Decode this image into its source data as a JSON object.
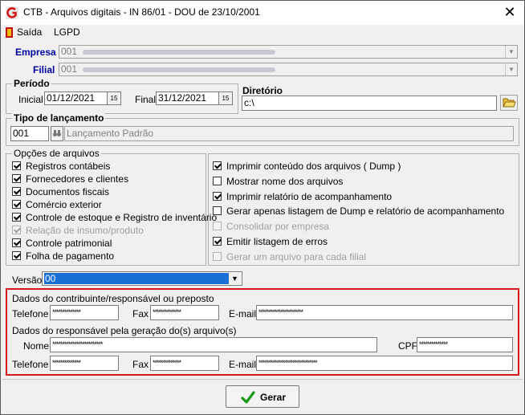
{
  "window": {
    "title": "CTB - Arquivos digitais - IN 86/01 - DOU de 23/10/2001",
    "close_symbol": "✕"
  },
  "menu": {
    "exit": "Saída",
    "lgpd": "LGPD"
  },
  "company": {
    "label": "Empresa",
    "code": "001"
  },
  "branch": {
    "label": "Filial",
    "code": "001"
  },
  "period": {
    "title": "Período",
    "start_label": "Inicial",
    "start_value": "01/12/2021",
    "end_label": "Final",
    "end_value": "31/12/2021",
    "cal_glyph": "15"
  },
  "directory": {
    "label": "Diretório",
    "value": "c:\\"
  },
  "entry_type": {
    "title": "Tipo de lançamento",
    "code": "001",
    "description": "Lançamento Padrão"
  },
  "file_options": {
    "title": "Opções de arquivos",
    "left": [
      {
        "label": "Registros contábeis",
        "checked": true,
        "enabled": true
      },
      {
        "label": "Fornecedores e clientes",
        "checked": true,
        "enabled": true
      },
      {
        "label": "Documentos fiscais",
        "checked": true,
        "enabled": true
      },
      {
        "label": "Comércio exterior",
        "checked": true,
        "enabled": true
      },
      {
        "label": "Controle de estoque e Registro de inventário",
        "checked": true,
        "enabled": true
      },
      {
        "label": "Relação de insumo/produto",
        "checked": true,
        "enabled": false
      },
      {
        "label": "Controle patrimonial",
        "checked": true,
        "enabled": true
      },
      {
        "label": "Folha de pagamento",
        "checked": true,
        "enabled": true
      }
    ],
    "right": [
      {
        "label": "Imprimir conteúdo dos arquivos ( Dump )",
        "checked": true,
        "enabled": true
      },
      {
        "label": "Mostrar nome dos arquivos",
        "checked": false,
        "enabled": true
      },
      {
        "label": "Imprimir relatório de acompanhamento",
        "checked": true,
        "enabled": true
      },
      {
        "label": "Gerar apenas listagem de Dump e relatório de acompanhamento",
        "checked": false,
        "enabled": true
      },
      {
        "label": "Consolidar por empresa",
        "checked": false,
        "enabled": false
      },
      {
        "label": "Emitir listagem de erros",
        "checked": true,
        "enabled": true
      },
      {
        "label": "Gerar um arquivo para cada filial",
        "checked": false,
        "enabled": false
      }
    ]
  },
  "version": {
    "label": "Versão",
    "value": "00"
  },
  "contributor": {
    "title": "Dados do contribuinte/responsável ou preposto",
    "phone_label": "Telefone",
    "phone_value": "**************",
    "fax_label": "Fax",
    "fax_value": "**************",
    "email_label": "E-mail",
    "email_value": "**********************"
  },
  "responsible": {
    "title": "Dados do responsável pela geração do(s) arquivo(s)",
    "name_label": "Nome",
    "name_value": "*************************",
    "cpf_label": "CPF",
    "cpf_value": "**************",
    "phone_label": "Telefone",
    "phone_value": "**************",
    "fax_label": "Fax",
    "fax_value": "**************",
    "email_label": "E-mail",
    "email_value": "*****************************"
  },
  "actions": {
    "generate": "Gerar"
  },
  "colors": {
    "accent_blue": "#0000a0",
    "highlight_red": "#d81818",
    "selection_blue": "#1a6fd6",
    "check_green": "#1a9a1a"
  }
}
